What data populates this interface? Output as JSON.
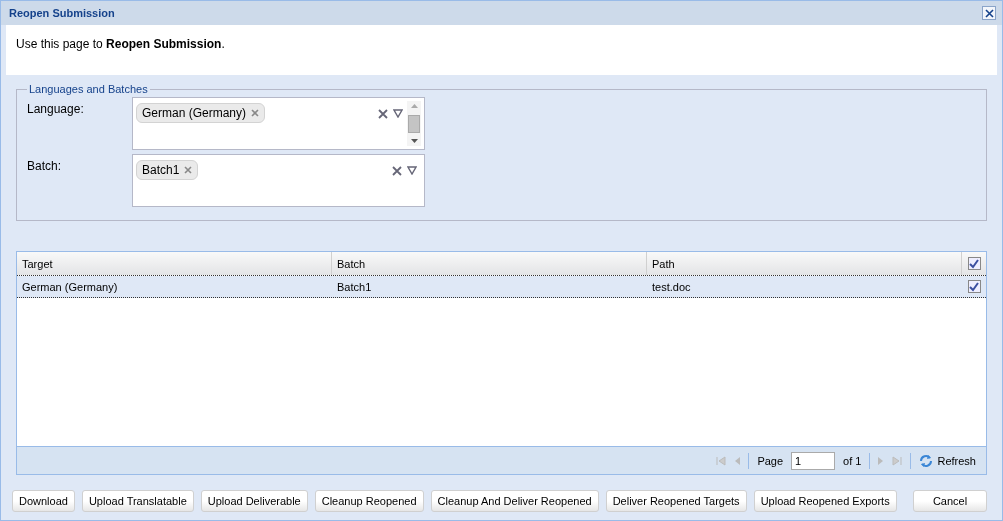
{
  "window": {
    "title": "Reopen Submission"
  },
  "intro": "Use this page to **Reopen Submission**.",
  "fieldset": {
    "legend": "Languages and Batches",
    "fields": [
      {
        "label": "Language:",
        "tags": [
          "German (Germany)"
        ],
        "scrollbar": true
      },
      {
        "label": "Batch:",
        "tags": [
          "Batch1"
        ],
        "scrollbar": false
      }
    ]
  },
  "grid": {
    "columns": [
      "Target",
      "Batch",
      "Path"
    ],
    "header_checked": true,
    "rows": [
      {
        "cells": [
          "German (Germany)",
          "Batch1",
          "test.doc"
        ],
        "checked": true,
        "selected": true
      }
    ]
  },
  "pager": {
    "label": "Page",
    "page": "1",
    "of": "of 1",
    "refresh": "Refresh"
  },
  "buttons": [
    "Download",
    "Upload Translatable",
    "Upload Deliverable",
    "Cleanup Reopened",
    "Cleanup And Deliver Reopened",
    "Deliver Reopened Targets",
    "Upload Reopened Exports"
  ],
  "cancel": "Cancel"
}
